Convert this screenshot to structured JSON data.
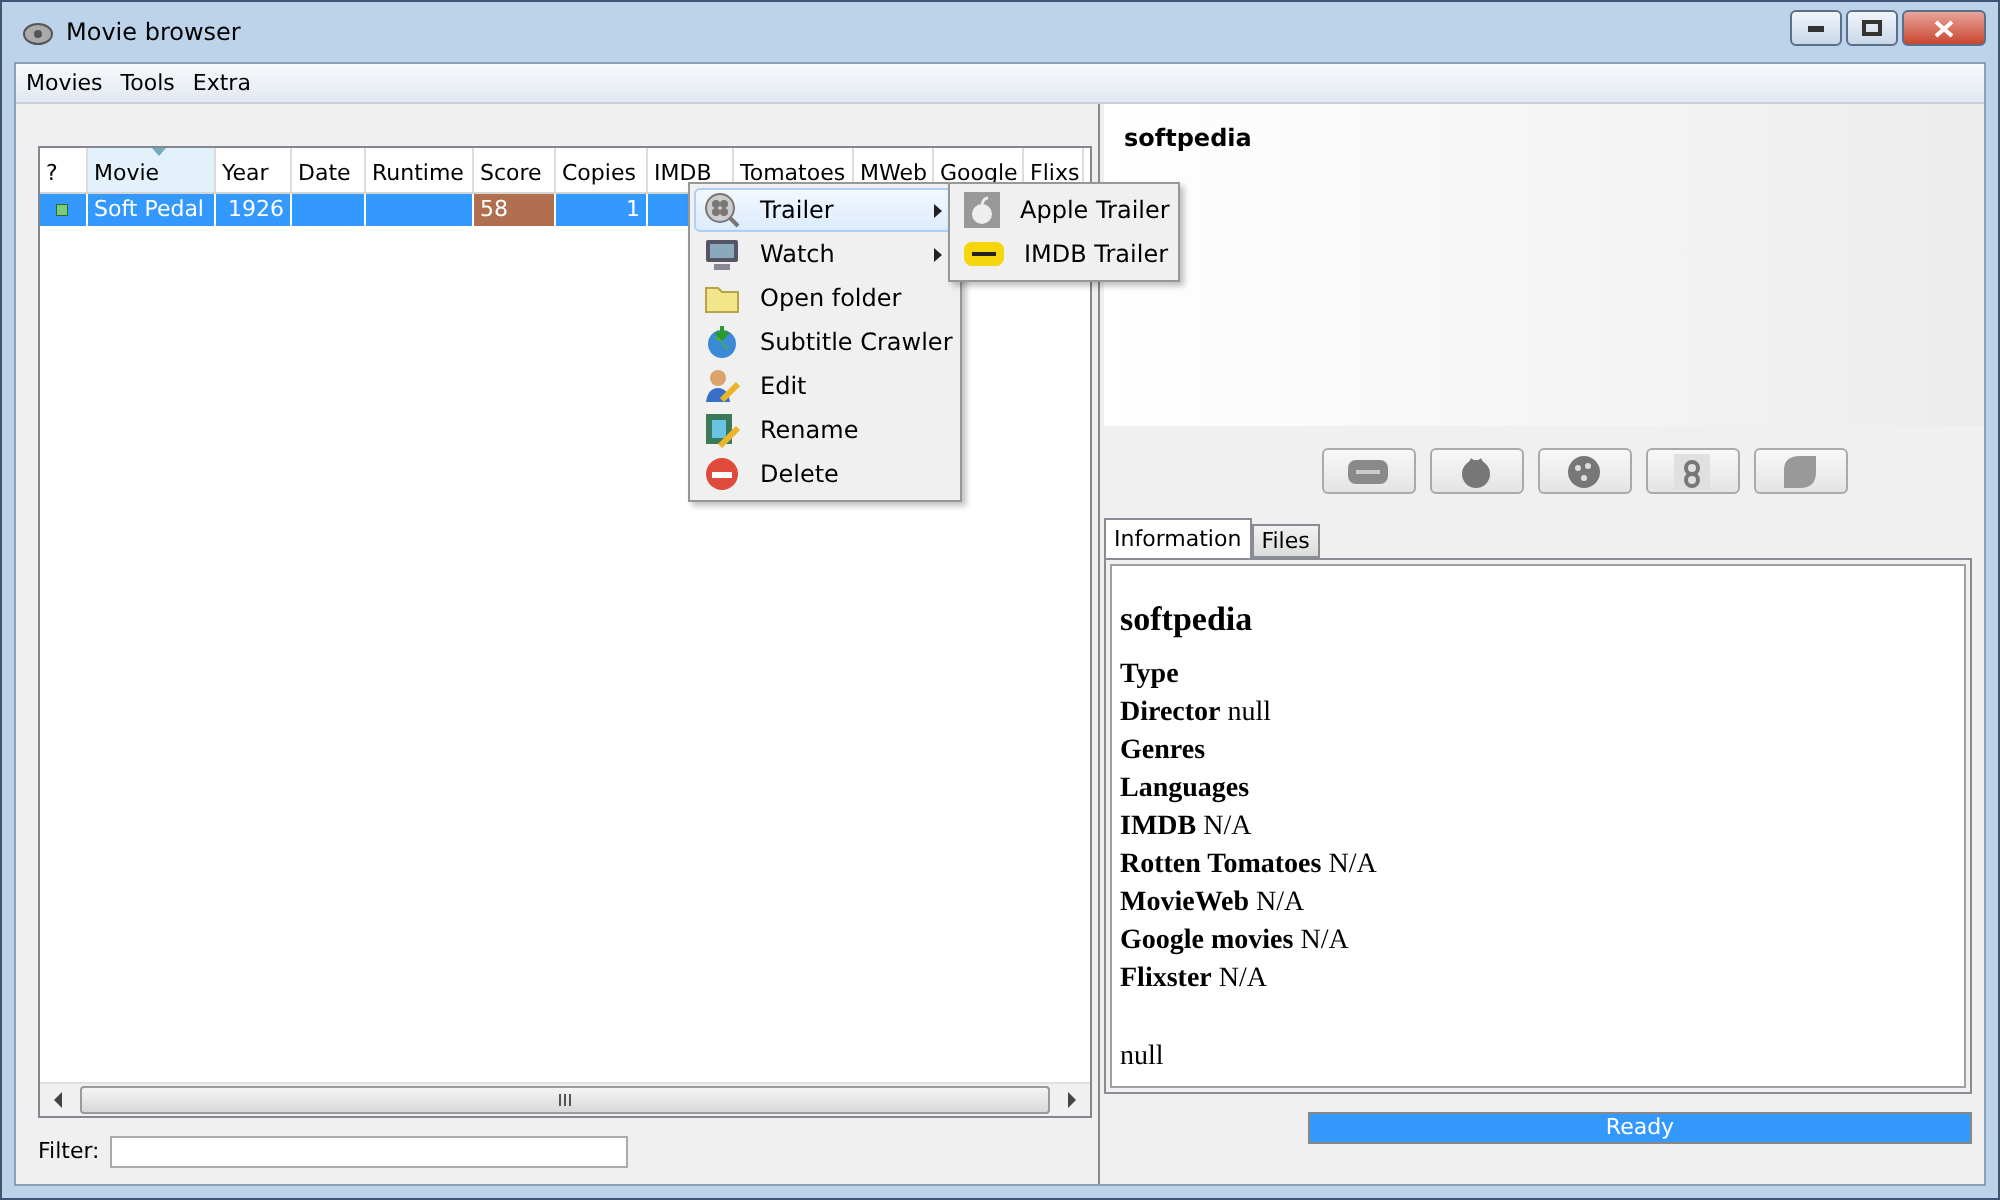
{
  "window": {
    "title": "Movie browser"
  },
  "menu": [
    "Movies",
    "Tools",
    "Extra"
  ],
  "table": {
    "columns": [
      {
        "label": "?",
        "selected": false
      },
      {
        "label": "Movie",
        "selected": true
      },
      {
        "label": "Year",
        "selected": false
      },
      {
        "label": "Date",
        "selected": false
      },
      {
        "label": "Runtime",
        "selected": false
      },
      {
        "label": "Score",
        "selected": false
      },
      {
        "label": "Copies",
        "selected": false
      },
      {
        "label": "IMDB",
        "selected": false
      },
      {
        "label": "Tomatoes",
        "selected": false
      },
      {
        "label": "MWeb",
        "selected": false
      },
      {
        "label": "Google",
        "selected": false
      },
      {
        "label": "Flixs",
        "selected": false
      }
    ],
    "rows": [
      {
        "movie": "Soft Pedal",
        "year": "1926",
        "score": "58",
        "copies": "1",
        "selected": true
      }
    ]
  },
  "context_menu": {
    "items": [
      {
        "label": "Trailer",
        "kind": "submenu",
        "selected": true
      },
      {
        "label": "Watch",
        "kind": "submenu",
        "selected": false
      },
      {
        "label": "Open folder",
        "kind": "item",
        "selected": false
      },
      {
        "label": "Subtitle Crawler",
        "kind": "item",
        "selected": false
      },
      {
        "label": "Edit",
        "kind": "item",
        "selected": false
      },
      {
        "label": "Rename",
        "kind": "item",
        "selected": false
      },
      {
        "label": "Delete",
        "kind": "item",
        "selected": false
      }
    ],
    "submenu": [
      "Apple Trailer",
      "IMDB Trailer"
    ]
  },
  "preview": {
    "title": "softpedia"
  },
  "tabs": [
    {
      "label": "Information",
      "selected": true
    },
    {
      "label": "Files",
      "selected": false
    }
  ],
  "info": {
    "title": "softpedia",
    "lines": [
      "**Type**",
      "**Director** null",
      "**Genres**",
      "**Languages**",
      "**IMDB** N/A",
      "**Rotten Tomatoes** N/A",
      "**MovieWeb** N/A",
      "**Google movies** N/A",
      "**Flixster** N/A"
    ],
    "footer": "null"
  },
  "filter": {
    "label": "Filter:"
  },
  "status": {
    "text": "Ready",
    "level": 1
  }
}
